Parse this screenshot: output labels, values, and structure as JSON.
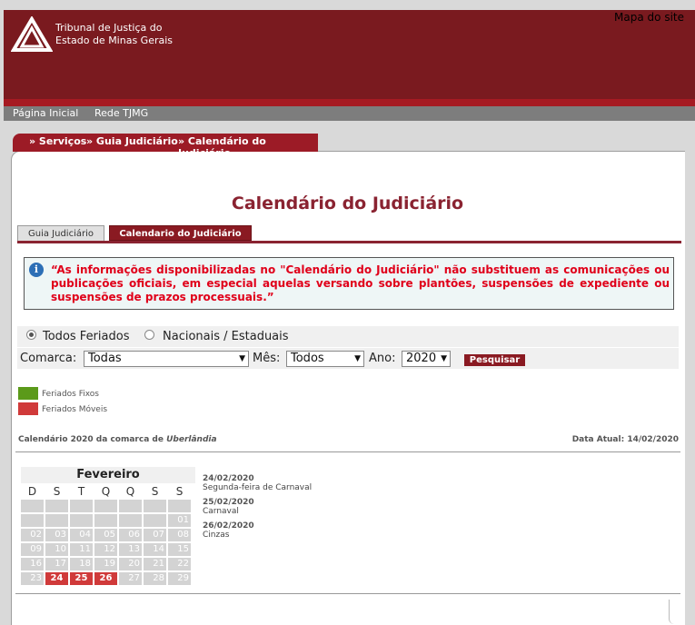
{
  "header": {
    "org_line1": "Tribunal de Justiça do",
    "org_line2": "Estado de Minas Gerais",
    "sitemap_label": "Mapa do site"
  },
  "topnav": {
    "home": "Página Inicial",
    "rede": "Rede TJMG"
  },
  "breadcrumb": {
    "item1": "» Serviços",
    "item2": "» Guia Judiciário",
    "item3": "» Calendário do Judiciário"
  },
  "page": {
    "title": "Calendário do Judiciário"
  },
  "tabs": [
    {
      "label": "Guia Judiciário",
      "active": false
    },
    {
      "label": "Calendario do Judiciário",
      "active": true
    }
  ],
  "notice": {
    "text": "“As informações disponibilizadas no \"Calendário do Judiciário\" não substituem as comunicações ou publicações oficiais, em especial aquelas versando sobre plantões, suspensões de expediente ou suspensões de prazos processuais.”"
  },
  "filters": {
    "radio_todos": "Todos Feriados",
    "radio_nacionais": "Nacionais / Estaduais",
    "comarca_label": "Comarca:",
    "comarca_value": "Todas",
    "mes_label": "Mês:",
    "mes_value": "Todos",
    "ano_label": "Ano:",
    "ano_value": "2020",
    "search_label": "Pesquisar"
  },
  "legend": {
    "fixos": "Feriados Fixos",
    "moveis": "Feriados Móveis",
    "fixos_color": "#5b9a1a",
    "moveis_color": "#d03a3a"
  },
  "calendar": {
    "caption_prefix": "Calendário 2020 da comarca de",
    "comarca": "Uberlândia",
    "data_atual": "Data Atual: 14/02/2020",
    "month": "Fevereiro",
    "dow": [
      "D",
      "S",
      "T",
      "Q",
      "Q",
      "S",
      "S"
    ],
    "weeks": [
      [
        "",
        "",
        "",
        "",
        "",
        "",
        ""
      ],
      [
        "",
        "",
        "",
        "",
        "",
        "",
        "01"
      ],
      [
        "02",
        "03",
        "04",
        "05",
        "06",
        "07",
        "08"
      ],
      [
        "09",
        "10",
        "11",
        "12",
        "13",
        "14",
        "15"
      ],
      [
        "16",
        "17",
        "18",
        "19",
        "20",
        "21",
        "22"
      ],
      [
        "23",
        "24",
        "25",
        "26",
        "27",
        "28",
        "29"
      ]
    ],
    "moveis_days": [
      "24",
      "25",
      "26"
    ]
  },
  "holidays": [
    {
      "date": "24/02/2020",
      "name": "Segunda-feira de Carnaval"
    },
    {
      "date": "25/02/2020",
      "name": "Carnaval"
    },
    {
      "date": "26/02/2020",
      "name": "Cinzas"
    }
  ]
}
